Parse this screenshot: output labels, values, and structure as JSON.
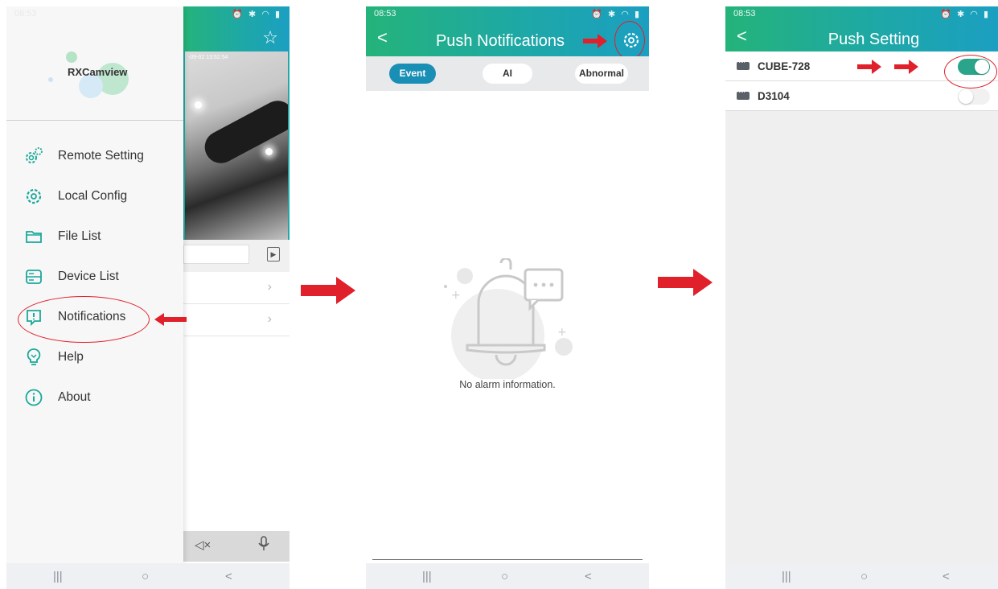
{
  "colors": {
    "header_start": "#24b37a",
    "header_end": "#1b9fc2",
    "active_tab": "#1a8fb6",
    "toggle_on": "#2aa58b",
    "annotation_red": "#e0202a"
  },
  "screen1": {
    "status_time": "08:53",
    "video_timestamp": "-09-02 13:52:54",
    "star_icon": "star-outline-icon",
    "drawer": {
      "logo_text": "RXCamview",
      "items": [
        {
          "label": "Remote Setting",
          "icon": "gears-icon"
        },
        {
          "label": "Local Config",
          "icon": "gear-icon"
        },
        {
          "label": "File List",
          "icon": "folder-icon"
        },
        {
          "label": "Device List",
          "icon": "server-icon"
        },
        {
          "label": "Notifications",
          "icon": "alert-bubble-icon"
        },
        {
          "label": "Help",
          "icon": "lightbulb-icon"
        },
        {
          "label": "About",
          "icon": "info-icon"
        }
      ]
    },
    "controls": {
      "mute_icon": "speaker-mute-icon",
      "mic_icon": "microphone-icon"
    }
  },
  "screen2": {
    "status_time": "08:53",
    "title": "Push Notifications",
    "tabs": [
      {
        "label": "Event",
        "active": true
      },
      {
        "label": "AI",
        "active": false
      },
      {
        "label": "Abnormal",
        "active": false
      }
    ],
    "empty_message": "No alarm information."
  },
  "screen3": {
    "status_time": "08:53",
    "title": "Push Setting",
    "devices": [
      {
        "name": "CUBE-728",
        "enabled": true
      },
      {
        "name": "D3104",
        "enabled": false
      }
    ]
  },
  "navbar": {
    "recent": "|||",
    "home": "○",
    "back": "<"
  }
}
